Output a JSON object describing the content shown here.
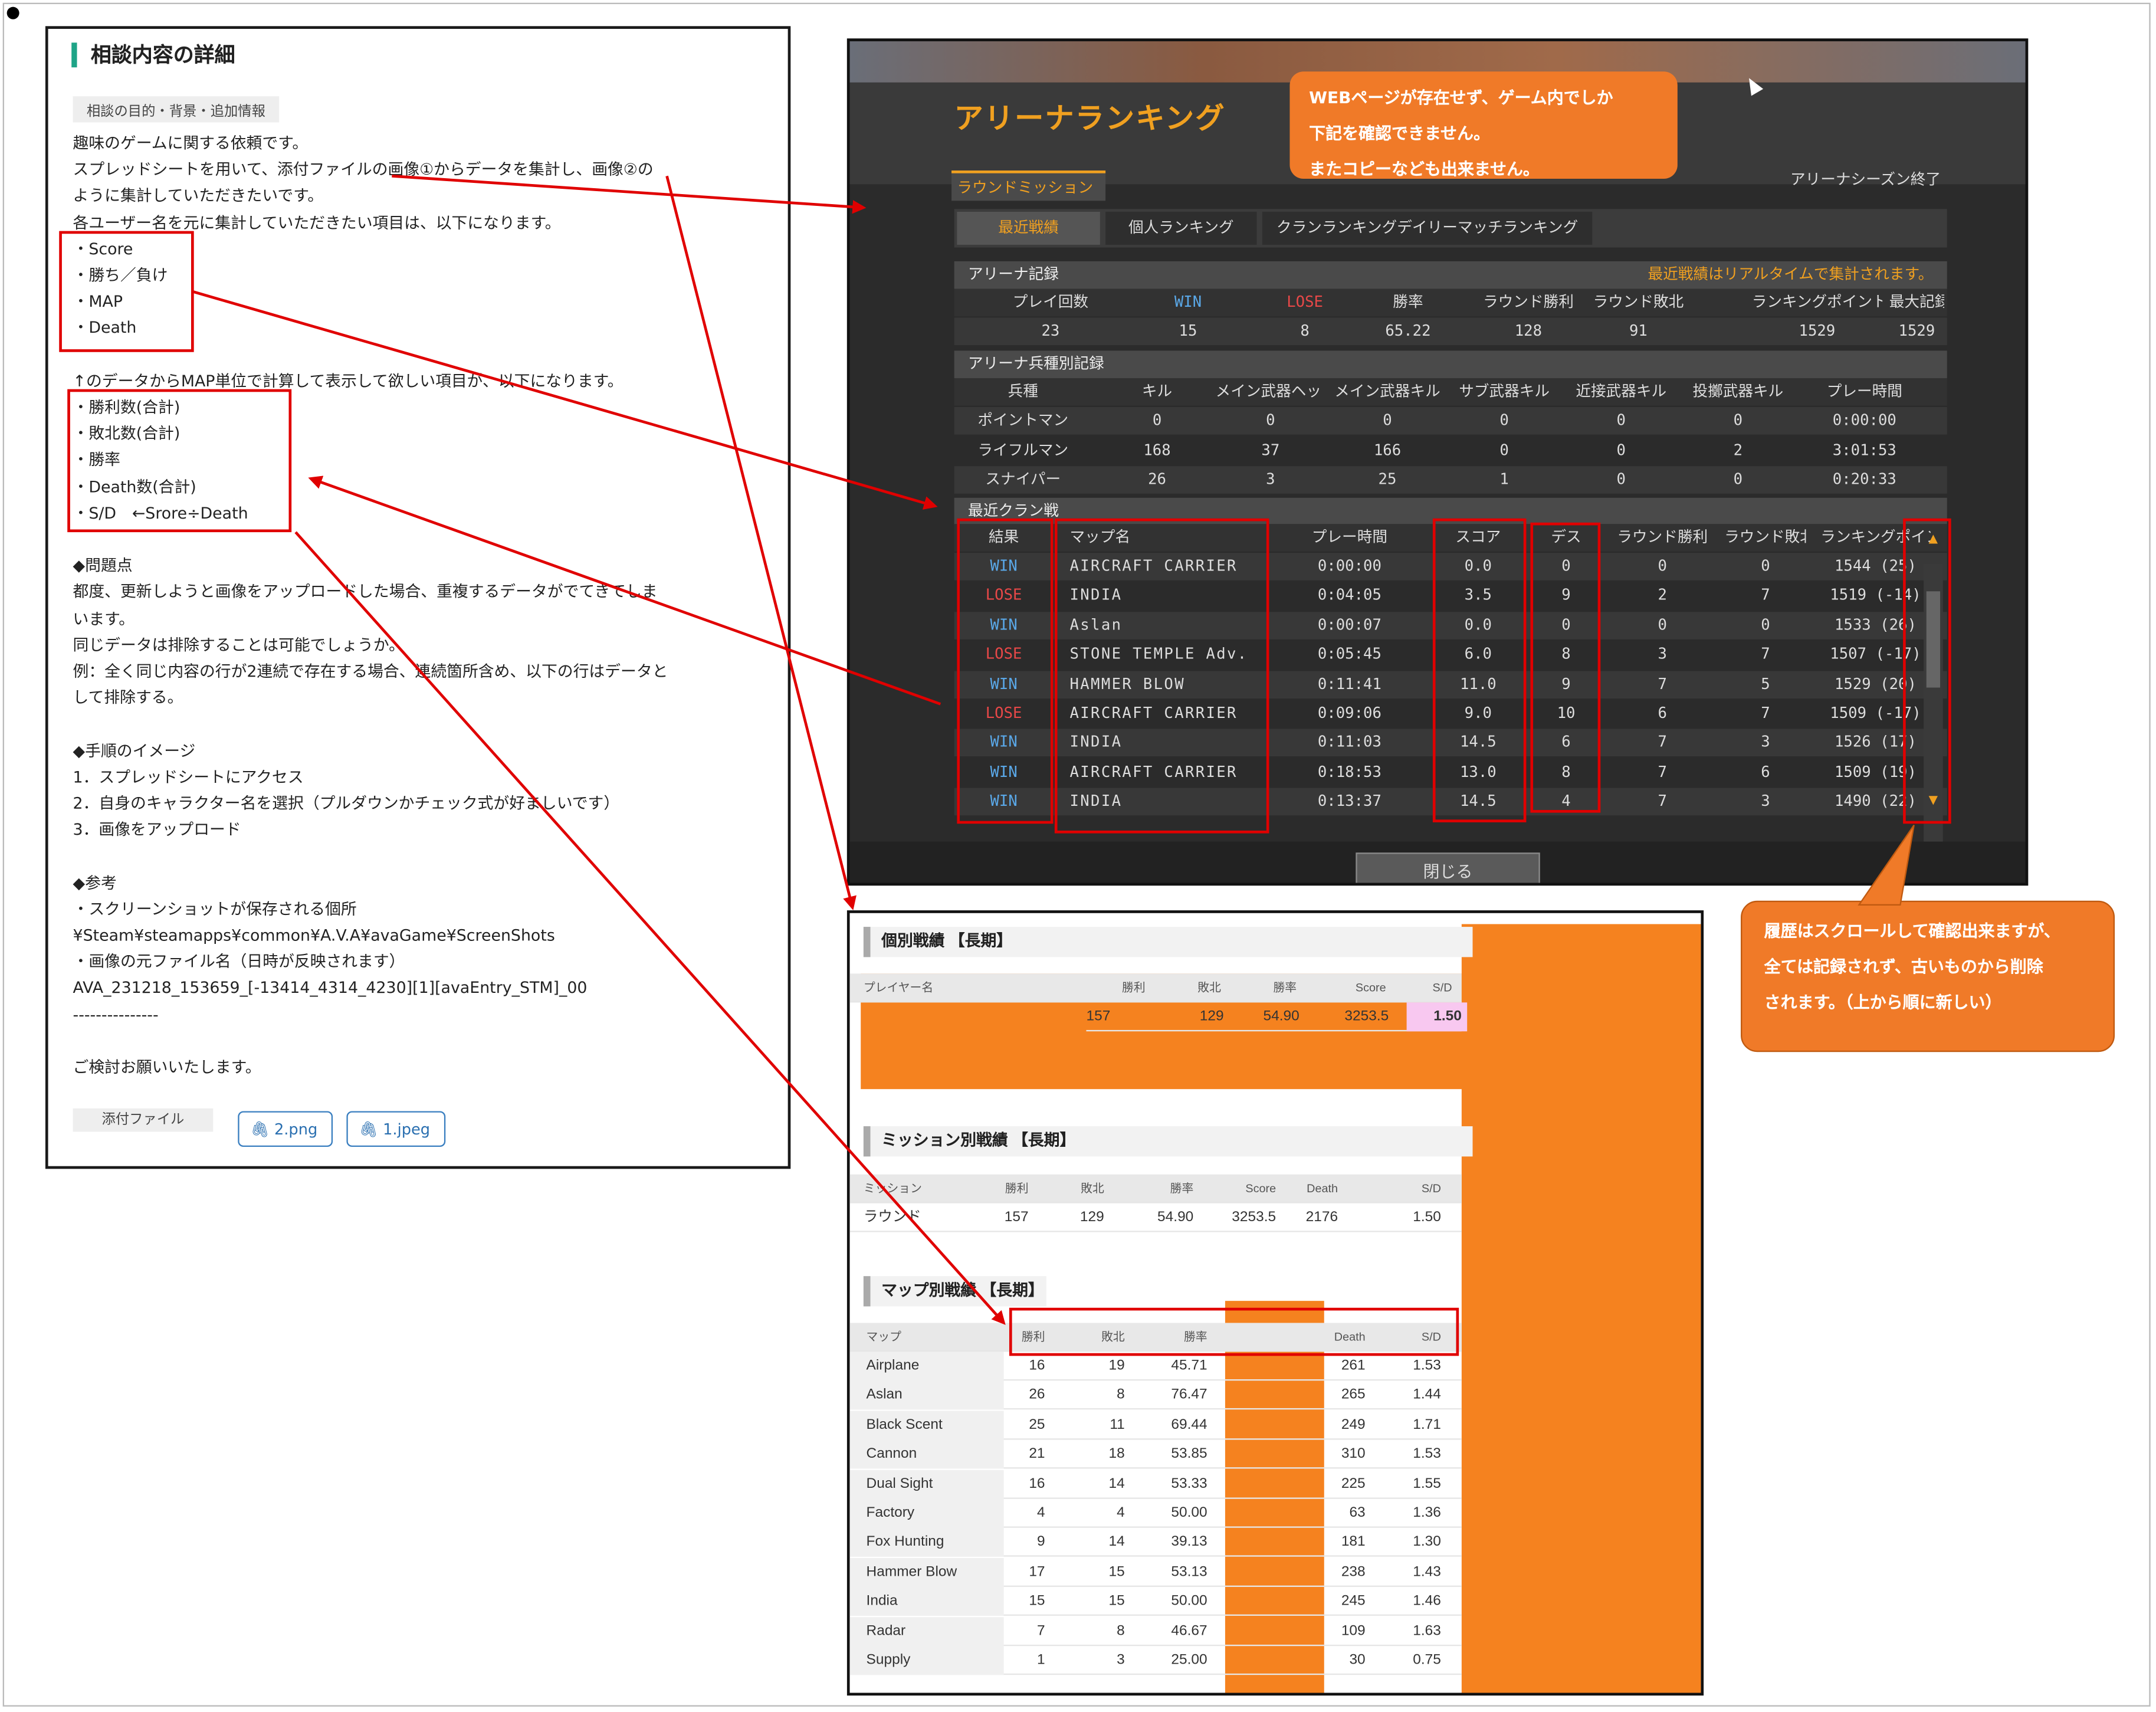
{
  "doc": {
    "title": "相談内容の詳細",
    "tag": "相談の目的・背景・追加情報",
    "lines": [
      "趣味のゲームに関する依頼です。",
      "スプレッドシートを用いて、添付ファイルの画像①からデータを集計し、画像②の",
      "ように集計していただきたいです。",
      "各ユーザー名を元に集計していただきたい項目は、以下になります。",
      "・Score",
      "・勝ち／負け",
      "・MAP",
      "・Death",
      "",
      "↑のデータからMAP単位で計算して表示して欲しい項目が、以下になります。",
      "・勝利数(合計)",
      "・敗北数(合計)",
      "・勝率",
      "・Death数(合計)",
      "・S/D　←Srore÷Death",
      "",
      "◆問題点",
      "都度、更新しようと画像をアップロードした場合、重複するデータがでてきてしま",
      "います。",
      "同じデータは排除することは可能でしょうか。",
      "例：全く同じ内容の行が2連続で存在する場合、連続箇所含め、以下の行はデータと",
      "して排除する。",
      "",
      "◆手順のイメージ",
      "1．スプレッドシートにアクセス",
      "2．自身のキャラクター名を選択（プルダウンかチェック式が好ましいです）",
      "3．画像をアップロード",
      "",
      "◆参考",
      "・スクリーンショットが保存される個所",
      "¥Steam¥steamapps¥common¥A.V.A¥avaGame¥ScreenShots",
      "・画像の元ファイル名（日時が反映されます）",
      "AVA_231218_153659_[-13414_4314_4230][1][avaEntry_STM]_00",
      "---------------",
      "",
      "ご検討お願いいたします。"
    ],
    "attach_label": "添付ファイル",
    "attachments": [
      "2.png",
      "1.jpeg"
    ]
  },
  "game": {
    "title": "アリーナランキング",
    "callout": [
      "WEBページが存在せず、ゲーム内でしか",
      "下記を確認できません。",
      "またコピーなども出来ません。"
    ],
    "season": "アリーナシーズン終了",
    "main_tab": "ラウンドミッション",
    "sub_tabs": [
      "最近戦績",
      "個人ランキング",
      "クランランキングデイリーマッチランキング"
    ],
    "arena_record": {
      "title": "アリーナ記録",
      "note": "最近戦績はリアルタイムで集計されます。",
      "headers": [
        "プレイ回数",
        "WIN",
        "LOSE",
        "勝率",
        "ラウンド勝利",
        "ラウンド敗北",
        "ランキングポイント",
        "最大記録"
      ],
      "values": [
        "23",
        "15",
        "8",
        "65.22",
        "128",
        "91",
        "1529",
        "1529"
      ]
    },
    "class_record": {
      "title": "アリーナ兵種別記録",
      "headers": [
        "兵種",
        "キル",
        "メイン武器ヘッドショット",
        "メイン武器キル",
        "サブ武器キル",
        "近接武器キル",
        "投擲武器キル",
        "プレー時間"
      ],
      "rows": [
        [
          "ポイントマン",
          "0",
          "0",
          "0",
          "0",
          "0",
          "0",
          "0:00:00"
        ],
        [
          "ライフルマン",
          "168",
          "37",
          "166",
          "0",
          "0",
          "2",
          "3:01:53"
        ],
        [
          "スナイパー",
          "26",
          "3",
          "25",
          "1",
          "0",
          "0",
          "0:20:33"
        ]
      ]
    },
    "clan": {
      "title": "最近クラン戦",
      "headers": [
        "結果",
        "マップ名",
        "プレー時間",
        "スコア",
        "デス",
        "ラウンド勝利",
        "ラウンド敗北",
        "ランキングポイント"
      ],
      "rows": [
        [
          "WIN",
          "AIRCRAFT CARRIER",
          "0:00:00",
          "0.0",
          "0",
          "0",
          "0",
          "1544 (25)"
        ],
        [
          "LOSE",
          "INDIA",
          "0:04:05",
          "3.5",
          "9",
          "2",
          "7",
          "1519 (-14)"
        ],
        [
          "WIN",
          "Aslan",
          "0:00:07",
          "0.0",
          "0",
          "0",
          "0",
          "1533 (26)"
        ],
        [
          "LOSE",
          "STONE TEMPLE Adv.",
          "0:05:45",
          "6.0",
          "8",
          "3",
          "7",
          "1507 (-17)"
        ],
        [
          "WIN",
          "HAMMER BLOW",
          "0:11:41",
          "11.0",
          "9",
          "7",
          "5",
          "1529 (20)"
        ],
        [
          "LOSE",
          "AIRCRAFT CARRIER",
          "0:09:06",
          "9.0",
          "10",
          "6",
          "7",
          "1509 (-17)"
        ],
        [
          "WIN",
          "INDIA",
          "0:11:03",
          "14.5",
          "6",
          "7",
          "3",
          "1526 (17)"
        ],
        [
          "WIN",
          "AIRCRAFT CARRIER",
          "0:18:53",
          "13.0",
          "8",
          "7",
          "6",
          "1509 (19)"
        ],
        [
          "WIN",
          "INDIA",
          "0:13:37",
          "14.5",
          "4",
          "7",
          "3",
          "1490 (22)"
        ]
      ]
    },
    "close_label": "閉じる"
  },
  "sheet": {
    "individual": {
      "title": "個別戦績 【長期】",
      "headers": [
        "プレイヤー名",
        "勝利",
        "敗北",
        "勝率",
        "Score",
        "S/D"
      ],
      "values": [
        "157",
        "129",
        "54.90",
        "3253.5",
        "1.50"
      ]
    },
    "mission": {
      "title": "ミッション別戦績 【長期】",
      "headers": [
        "ミッション",
        "勝利",
        "敗北",
        "勝率",
        "Score",
        "Death",
        "S/D"
      ],
      "row": [
        "ラウンド",
        "157",
        "129",
        "54.90",
        "3253.5",
        "2176",
        "1.50"
      ]
    },
    "map": {
      "title": "マップ別戦績 【長期】",
      "headers": [
        "マップ",
        "勝利",
        "敗北",
        "勝率",
        "Death",
        "S/D"
      ],
      "rows": [
        [
          "Airplane",
          "16",
          "19",
          "45.71",
          "261",
          "1.53"
        ],
        [
          "Aslan",
          "26",
          "8",
          "76.47",
          "265",
          "1.44"
        ],
        [
          "Black Scent",
          "25",
          "11",
          "69.44",
          "249",
          "1.71"
        ],
        [
          "Cannon",
          "21",
          "18",
          "53.85",
          "310",
          "1.53"
        ],
        [
          "Dual Sight",
          "16",
          "14",
          "53.33",
          "225",
          "1.55"
        ],
        [
          "Factory",
          "4",
          "4",
          "50.00",
          "63",
          "1.36"
        ],
        [
          "Fox Hunting",
          "9",
          "14",
          "39.13",
          "181",
          "1.30"
        ],
        [
          "Hammer Blow",
          "17",
          "15",
          "53.13",
          "238",
          "1.43"
        ],
        [
          "India",
          "15",
          "15",
          "50.00",
          "245",
          "1.46"
        ],
        [
          "Radar",
          "7",
          "8",
          "46.67",
          "109",
          "1.63"
        ],
        [
          "Supply",
          "1",
          "3",
          "25.00",
          "30",
          "0.75"
        ]
      ]
    }
  },
  "callout2": [
    "履歴はスクロールして確認出来ますが、",
    "全ては記録されず、古いものから削除",
    "されます。（上から順に新しい）"
  ],
  "colors": {
    "win": "#5aa8e8",
    "lose": "#e84848",
    "accent": "#f0a020",
    "orange": "#f5821f",
    "red_annot": "#e00000"
  }
}
